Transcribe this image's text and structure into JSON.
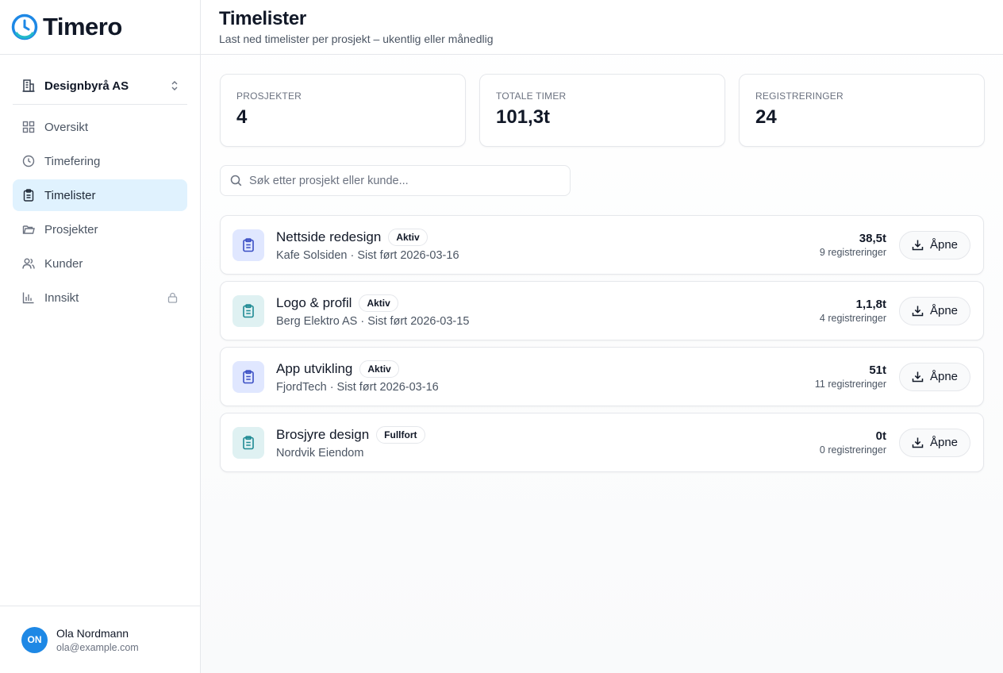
{
  "brand": {
    "name": "Timero"
  },
  "org": {
    "name": "Designbyrå AS"
  },
  "nav": [
    {
      "label": "Oversikt",
      "icon": "grid-icon",
      "active": false
    },
    {
      "label": "Timefering",
      "icon": "clock-icon",
      "active": false
    },
    {
      "label": "Timelister",
      "icon": "clipboard-icon",
      "active": true
    },
    {
      "label": "Prosjekter",
      "icon": "folder-icon",
      "active": false
    },
    {
      "label": "Kunder",
      "icon": "users-icon",
      "active": false
    },
    {
      "label": "Innsikt",
      "icon": "bar-chart-icon",
      "active": false,
      "locked": true
    }
  ],
  "user": {
    "initials": "ON",
    "name": "Ola Nordmann",
    "email": "ola@example.com"
  },
  "header": {
    "title": "Timelister",
    "subtitle": "Last ned timelister per prosjekt – ukentlig eller månedlig"
  },
  "stats": [
    {
      "label": "PROSJEKTER",
      "value": "4"
    },
    {
      "label": "TOTALE TIMER",
      "value": "101,3t"
    },
    {
      "label": "REGISTRERINGER",
      "value": "24"
    }
  ],
  "search": {
    "placeholder": "Søk etter prosjekt eller kunde..."
  },
  "open_label": "Åpne",
  "projects": [
    {
      "name": "Nettside redesign",
      "status": "Aktiv",
      "subtitle": "Kafe Solsiden · Sist ført 2026-03-16",
      "hours": "38,5t",
      "registrations": "9 registreringer",
      "icon_bg": "#e0e7ff",
      "icon_color": "#3b4fc4"
    },
    {
      "name": "Logo & profil",
      "status": "Aktiv",
      "subtitle": "Berg Elektro AS · Sist ført 2026-03-15",
      "hours": "1,1,8t",
      "registrations": "4 registreringer",
      "icon_bg": "#dff1f2",
      "icon_color": "#1f8a93"
    },
    {
      "name": "App utvikling",
      "status": "Aktiv",
      "subtitle": "FjordTech · Sist ført 2026-03-16",
      "hours": "51t",
      "registrations": "11 registreringer",
      "icon_bg": "#e0e7ff",
      "icon_color": "#3b4fc4"
    },
    {
      "name": "Brosjyre design",
      "status": "Fullfort",
      "subtitle": "Nordvik Eiendom",
      "hours": "0t",
      "registrations": "0 registreringer",
      "icon_bg": "#dff1f2",
      "icon_color": "#1f8a93"
    }
  ],
  "colors": {
    "accent": "#0ea5e9",
    "active_bg": "#e0f2fe",
    "avatar": "#1e88e5"
  }
}
